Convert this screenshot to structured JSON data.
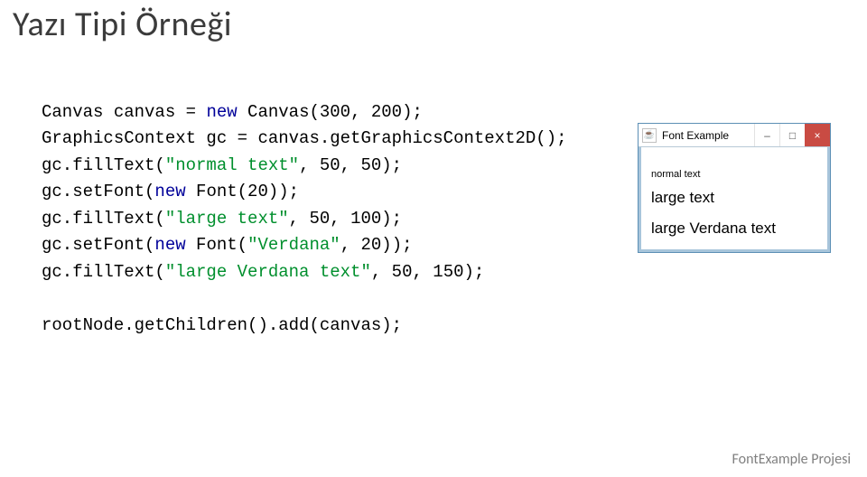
{
  "title": "Yazı Tipi Örneği",
  "code": {
    "l1a": "Canvas canvas = ",
    "l1b": "new",
    "l1c": " Canvas(300, 200);",
    "l2a": "GraphicsContext gc = canvas.getGraphicsContext2D();",
    "l3a": "gc.fillText(",
    "l3s": "\"normal text\"",
    "l3b": ", 50, 50);",
    "l4a": "gc.setFont(",
    "l4b": "new",
    "l4c": " Font(20));",
    "l5a": "gc.fillText(",
    "l5s": "\"large text\"",
    "l5b": ", 50, 100);",
    "l6a": "gc.setFont(",
    "l6b": "new",
    "l6c": " Font(",
    "l6s": "\"Verdana\"",
    "l6d": ", 20));",
    "l7a": "gc.fillText(",
    "l7s": "\"large Verdana text\"",
    "l7b": ", 50, 150);",
    "l8": "rootNode.getChildren().add(canvas);"
  },
  "window": {
    "title": "Font Example",
    "favicon_glyph": "☕",
    "min_glyph": "–",
    "max_glyph": "□",
    "close_glyph": "×",
    "line1": "normal text",
    "line2": "large text",
    "line3": "large Verdana text"
  },
  "footer": "FontExample Projesi"
}
